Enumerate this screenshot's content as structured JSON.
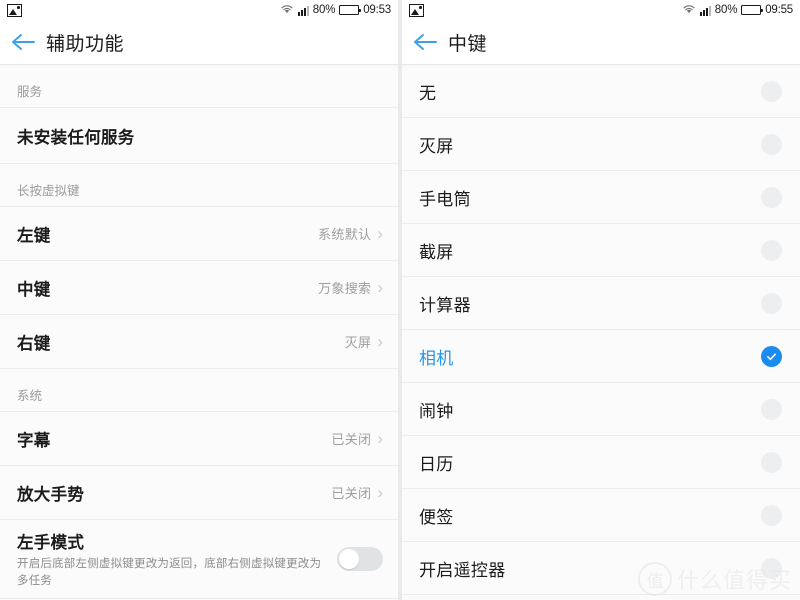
{
  "theme": {
    "accent_blue": "#2196f3",
    "check_blue": "#1a8cf0",
    "page_bg": "#fbfbfb",
    "divider": "#ececec",
    "label_gray": "#9b9b9b"
  },
  "left_screen": {
    "status_bar": {
      "image_icon": "image-icon",
      "wifi_icon": "wifi-icon",
      "signal_icon": "signal-icon",
      "battery_percent": "80%",
      "battery_icon": "battery-icon",
      "time": "09:53"
    },
    "header": {
      "back_icon": "back-arrow-icon",
      "title": "辅助功能"
    },
    "sections": [
      {
        "header": "服务",
        "rows": [
          {
            "label": "未安装任何服务",
            "value": "",
            "chevron": false
          }
        ]
      },
      {
        "header": "长按虚拟键",
        "rows": [
          {
            "label": "左键",
            "value": "系统默认",
            "chevron": true
          },
          {
            "label": "中键",
            "value": "万象搜索",
            "chevron": true
          },
          {
            "label": "右键",
            "value": "灭屏",
            "chevron": true
          }
        ]
      },
      {
        "header": "系统",
        "rows": [
          {
            "label": "字幕",
            "value": "已关闭",
            "chevron": true
          },
          {
            "label": "放大手势",
            "value": "已关闭",
            "chevron": true
          }
        ]
      }
    ],
    "toggle_row": {
      "label": "左手模式",
      "sub": "开启后底部左侧虚拟键更改为返回，底部右侧虚拟键更改为多任务",
      "toggle_state": "off"
    },
    "chevron_glyph": "›"
  },
  "right_screen": {
    "status_bar": {
      "image_icon": "image-icon",
      "wifi_icon": "wifi-icon",
      "signal_icon": "signal-icon",
      "battery_percent": "80%",
      "battery_icon": "battery-icon",
      "time": "09:55"
    },
    "header": {
      "back_icon": "back-arrow-icon",
      "title": "中键"
    },
    "options": [
      {
        "label": "无",
        "selected": false
      },
      {
        "label": "灭屏",
        "selected": false
      },
      {
        "label": "手电筒",
        "selected": false
      },
      {
        "label": "截屏",
        "selected": false
      },
      {
        "label": "计算器",
        "selected": false
      },
      {
        "label": "相机",
        "selected": true
      },
      {
        "label": "闹钟",
        "selected": false
      },
      {
        "label": "日历",
        "selected": false
      },
      {
        "label": "便签",
        "selected": false
      },
      {
        "label": "开启遥控器",
        "selected": false
      }
    ],
    "watermark": {
      "badge": "值",
      "text": "什么值得买"
    }
  }
}
